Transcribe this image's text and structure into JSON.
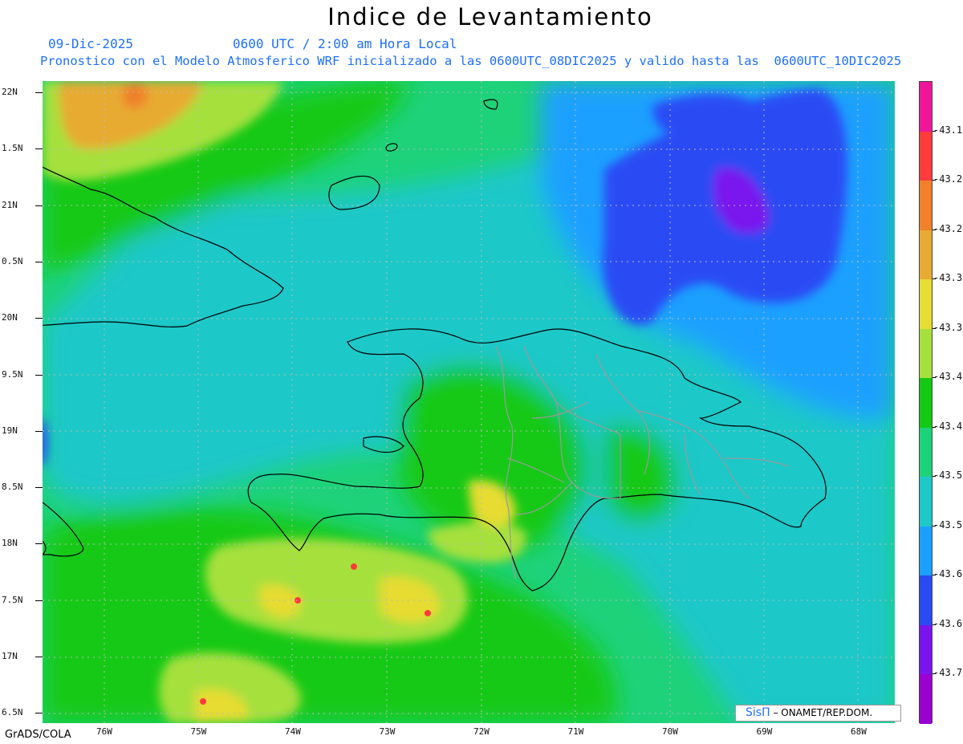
{
  "header": {
    "title": "Indice de Levantamiento",
    "date": "09-Dic-2025",
    "time": "0600 UTC / 2:00 am Hora Local",
    "description": "Pronostico con el Modelo Atmosferico WRF inicializado a las 0600UTC_08DIC2025 y valido hasta las  0600UTC_10DIC2025"
  },
  "axes": {
    "lat_labels": [
      "22N",
      "1.5N",
      "21N",
      "0.5N",
      "20N",
      "9.5N",
      "19N",
      "8.5N",
      "18N",
      "7.5N",
      "17N",
      "6.5N"
    ],
    "lon_labels": [
      "76W",
      "75W",
      "74W",
      "73W",
      "72W",
      "71W",
      "70W",
      "69W",
      "68W"
    ]
  },
  "colorbar": {
    "labels": [
      "-43.1",
      "-43.2",
      "-43.2",
      "-43.3",
      "-43.3",
      "-43.4",
      "-43.4",
      "-43.5",
      "-43.5",
      "-43.6",
      "-43.6",
      "-43.7"
    ],
    "colors": [
      "#f0169a",
      "#ff3b3b",
      "#f0802a",
      "#e7ab33",
      "#e6dc32",
      "#a6e03c",
      "#14c914",
      "#1ed27a",
      "#1ec8c8",
      "#1aa0ff",
      "#2a4bf4",
      "#7a14ee",
      "#9a00d0"
    ]
  },
  "field_colors": {
    "purple": "#7a14ee",
    "blue": "#2a4bf4",
    "light_blue": "#1aa0ff",
    "cyan": "#1ec8c8",
    "sea_green": "#1ed27a",
    "green": "#14c914",
    "yellow_green": "#a6e03c",
    "yellow": "#e6dc32",
    "gold": "#e7ab33",
    "orange": "#f0802a",
    "red": "#ff3b3b"
  },
  "credits": {
    "left": "GrADS/COLA",
    "brand": "SisΠ",
    "right": "– ONAMET/REP.DOM."
  }
}
